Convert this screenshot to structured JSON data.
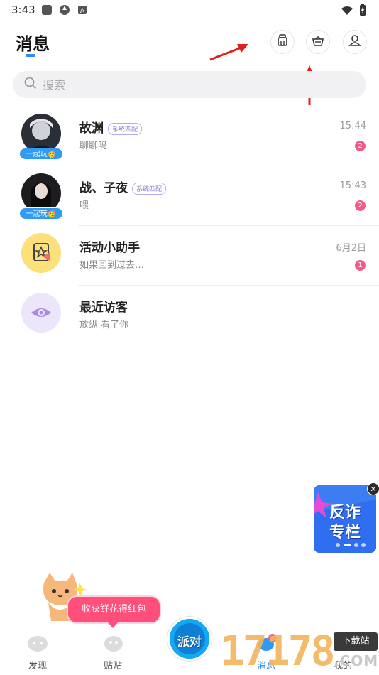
{
  "status_bar": {
    "time": "3:43"
  },
  "header": {
    "title": "消息"
  },
  "search": {
    "placeholder": "搜索"
  },
  "conversations": [
    {
      "name": "故渊",
      "badge": "系统匹配",
      "preview": "聊聊吗",
      "time": "15:44",
      "unread": "2",
      "tag": "一起玩🥳"
    },
    {
      "name": "战、子夜",
      "badge": "系统匹配",
      "preview": "喂",
      "time": "15:43",
      "unread": "2",
      "tag": "一起玩🥳"
    },
    {
      "name": "活动小助手",
      "preview": "如果回到过去…",
      "time": "6月2日",
      "unread": "1"
    },
    {
      "name": "最近访客",
      "preview": "放纵 看了你"
    }
  ],
  "promo": {
    "line1": "反诈",
    "line2": "专栏"
  },
  "tooltip": {
    "text": "收获鲜花得红包"
  },
  "bottom_nav": [
    {
      "label": "发现"
    },
    {
      "label": "贴贴"
    },
    {
      "label": "派对"
    },
    {
      "label": "消息"
    },
    {
      "label": "我的"
    }
  ],
  "watermark": {
    "digits": "17178",
    "site_label": "下载站",
    "domain": ".COM"
  },
  "colors": {
    "accent": "#2f8bf5",
    "unread": "#f05b86",
    "arrow": "#e02020"
  }
}
